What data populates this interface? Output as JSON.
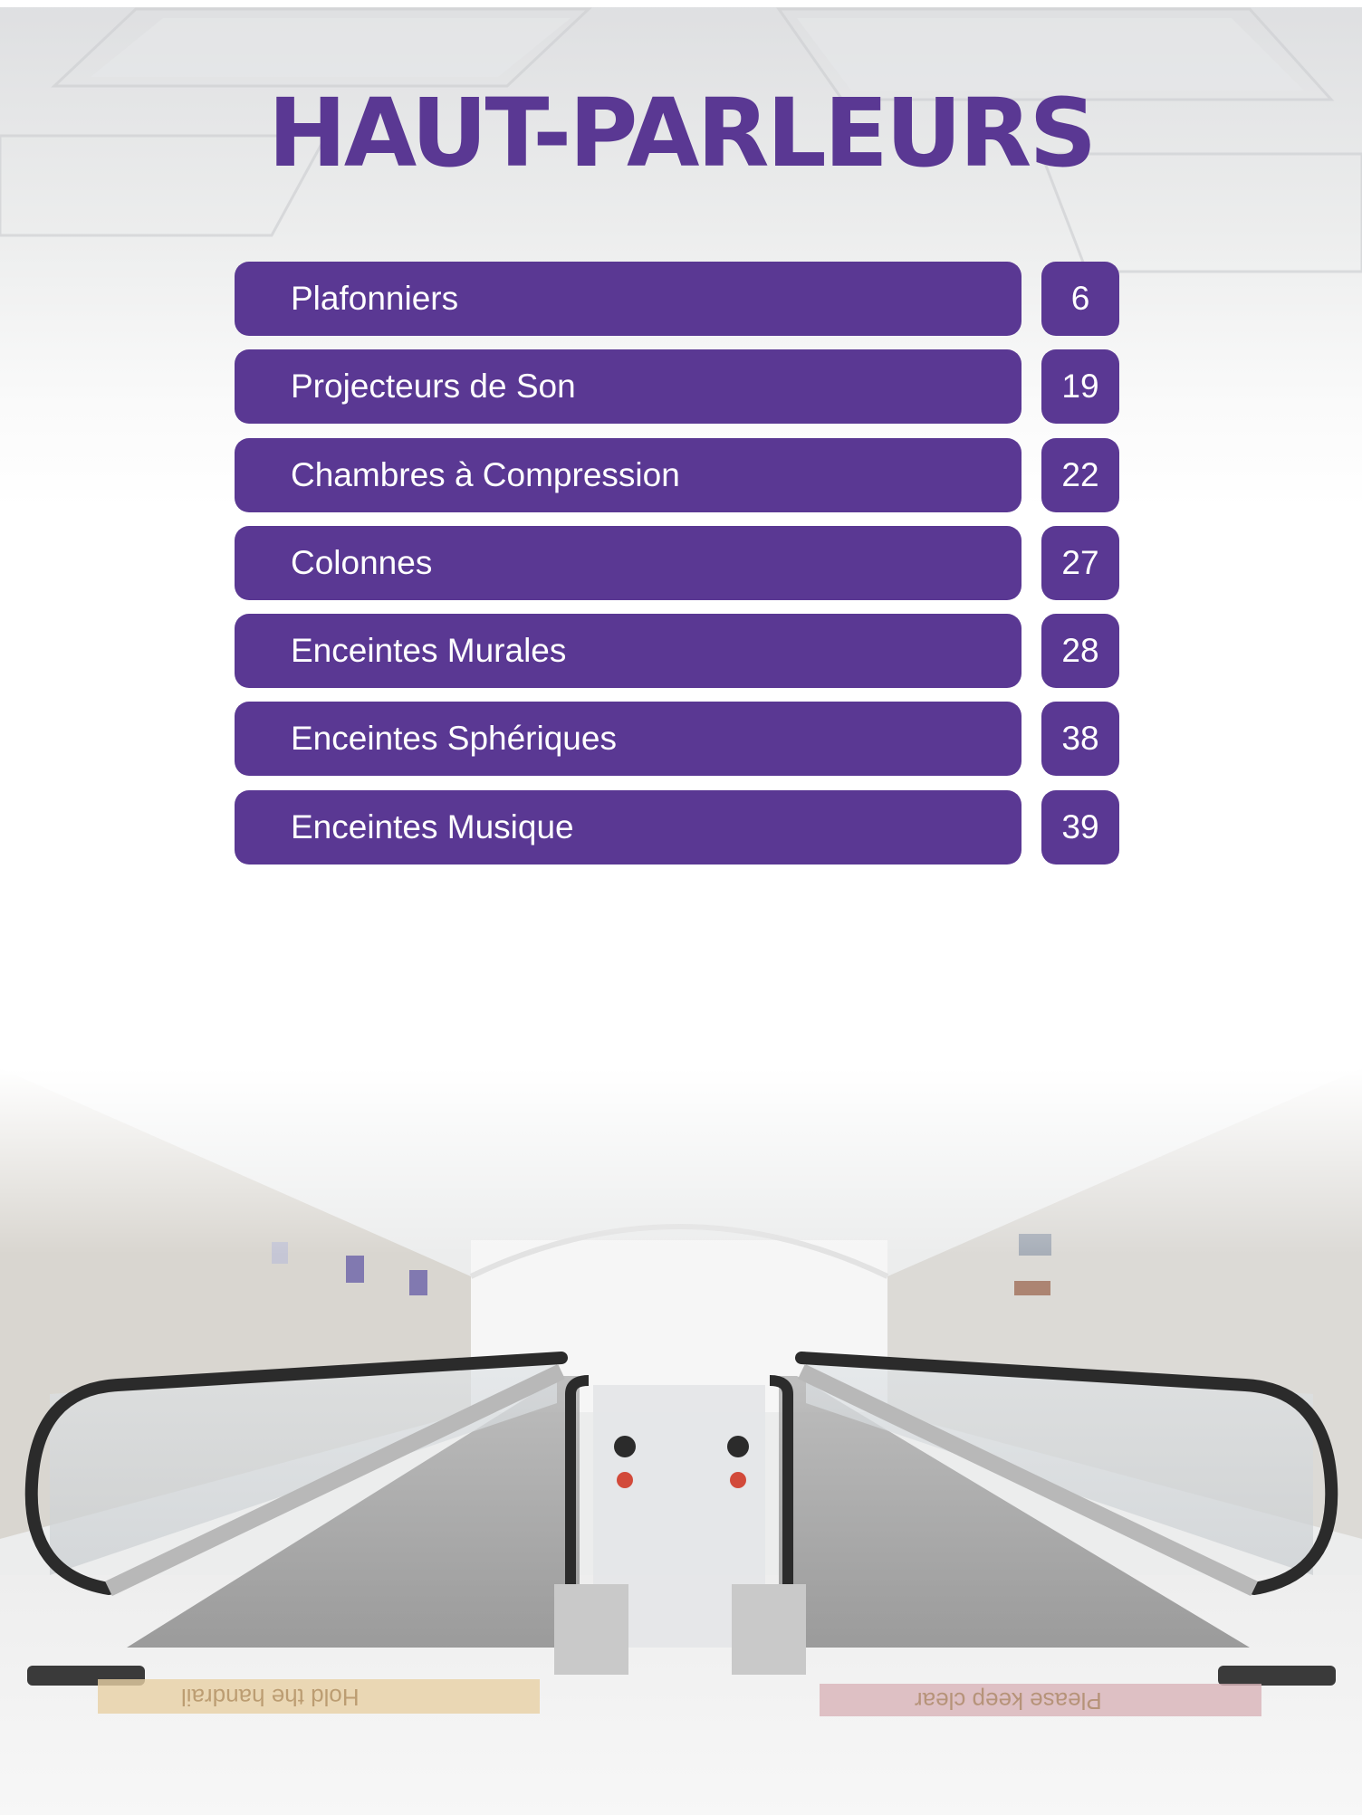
{
  "title": "HAUT-PARLEURS",
  "toc": [
    {
      "label": "Plafonniers",
      "page": "6"
    },
    {
      "label": "Projecteurs de Son",
      "page": "19"
    },
    {
      "label": "Chambres à Compression",
      "page": "22"
    },
    {
      "label": "Colonnes",
      "page": "27"
    },
    {
      "label": "Enceintes Murales",
      "page": "28"
    },
    {
      "label": "Enceintes Sphériques",
      "page": "38"
    },
    {
      "label": "Enceintes Musique",
      "page": "39"
    }
  ],
  "photo": {
    "left_sign": "Hold the handrail",
    "right_sign": "Please keep clear"
  },
  "colors": {
    "accent": "#5a3893",
    "text_on_accent": "#ffffff"
  }
}
